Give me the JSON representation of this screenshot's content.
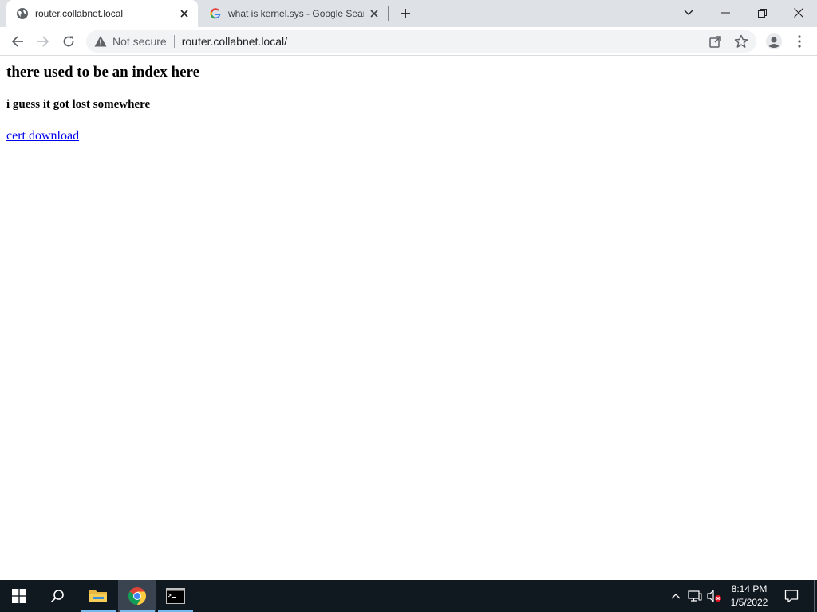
{
  "browser": {
    "tabs": [
      {
        "title": "router.collabnet.local",
        "active": true,
        "favicon": "globe-icon"
      },
      {
        "title": "what is kernel.sys - Google Search",
        "active": false,
        "favicon": "google-icon"
      }
    ],
    "omnibox": {
      "security_label": "Not secure",
      "url": "router.collabnet.local/"
    }
  },
  "page": {
    "heading": "there used to be an index here",
    "subheading": "i guess it got lost somewhere",
    "link_text": "cert download"
  },
  "taskbar": {
    "time": "8:14 PM",
    "date": "1/5/2022",
    "accent": "#76b9ed"
  }
}
